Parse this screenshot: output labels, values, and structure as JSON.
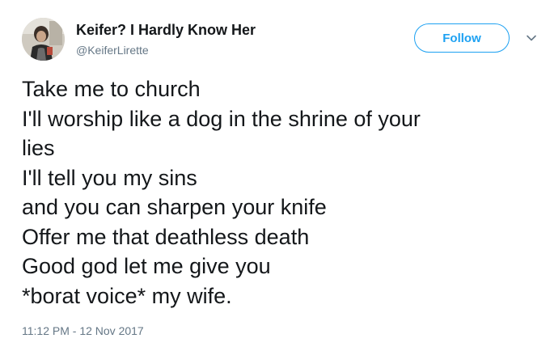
{
  "user": {
    "display_name": "Keifer? I Hardly Know Her",
    "handle": "@KeiferLirette"
  },
  "actions": {
    "follow_label": "Follow",
    "menu_icon": "chevron-down-icon"
  },
  "tweet": {
    "lines": [
      "Take me to church",
      "I'll worship like a dog in the shrine of your",
      "lies",
      "I'll tell you my sins",
      "and you can sharpen your knife",
      "Offer me that deathless death",
      "Good god let me give you",
      "*borat voice* my wife."
    ],
    "timestamp": "11:12 PM - 12 Nov 2017"
  },
  "colors": {
    "accent": "#1da1f2",
    "text": "#14171a",
    "secondary_text": "#657786"
  }
}
